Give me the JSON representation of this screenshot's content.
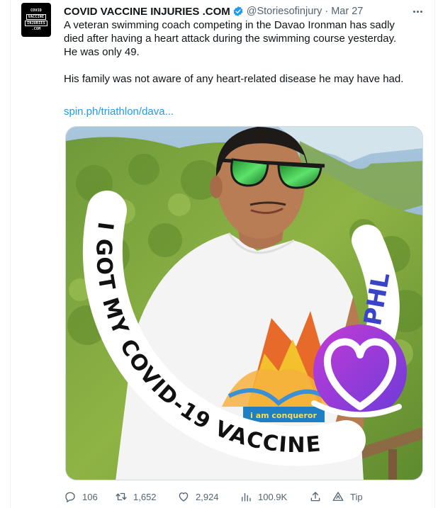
{
  "tweet": {
    "author_name": "COVID VACCINE INJURIES .COM",
    "handle": "@Storiesofinjury",
    "separator": "·",
    "date": "Mar 27",
    "avatar_lines": [
      "COVID",
      "VACCINE",
      "INJURIES",
      ".COM"
    ],
    "text_lines": [
      "A veteran swimming coach competing in the Davao Ironman has sadly",
      "died after having a heart attack during the swimming course yesterday.",
      "He was only 49.",
      "His family was not aware of any heart-related disease he may have had."
    ],
    "link": "spin.ph/triathlon/dava..."
  },
  "media": {
    "frame_text": "I GOT MY COVID-19 VACCINE",
    "country_code": "PHL",
    "shirt_text": "i am conqueror"
  },
  "actions": {
    "replies": "106",
    "retweets": "1,652",
    "likes": "2,924",
    "views": "100.9K",
    "tip": "Tip"
  },
  "colors": {
    "link": "#1d9bf0",
    "secondary_text": "#536471",
    "verified_badge": "#1d9bf0",
    "heart_badge_from": "#c43bd6",
    "heart_badge_to": "#6a3bd9"
  }
}
